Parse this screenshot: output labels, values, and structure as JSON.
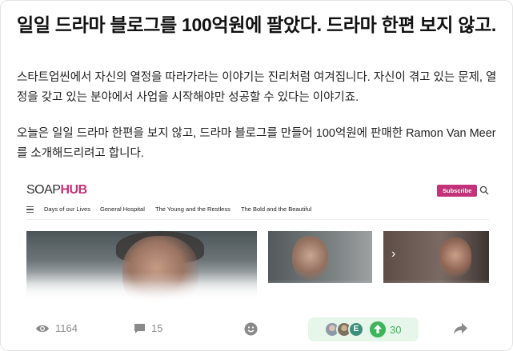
{
  "post": {
    "title": "일일 드라마 블로그를 100억원에 팔았다. 드라마 한편 보지 않고.",
    "paragraph1": "스타트업씬에서 자신의 열정을 따라가라는 이야기는 진리처럼 여겨집니다. 자신이 겪고 있는 문제, 열정을 갖고 있는 분야에서 사업을 시작해야만 성공할 수 있다는 이야기죠.",
    "paragraph2": "오늘은 일일 드라마 한편을 보지 않고, 드라마 블로그를 만들어 100억원에 판매한 Ramon Van Meer를 소개해드리려고 합니다."
  },
  "embed": {
    "logo_soap": "SOAP",
    "logo_hub": "HUB",
    "subscribe_label": "Subscribe",
    "nav_items": [
      "Days of our Lives",
      "General Hospital",
      "The Young and the Restless",
      "The Bold and the Beautiful"
    ],
    "brand_color": "#c4327a"
  },
  "stats": {
    "views": "1164",
    "comments": "15",
    "upvote_avatar_letter": "E",
    "upvotes": "30",
    "upvote_color": "#3fb55a"
  },
  "icons": [
    "eye-icon",
    "comment-icon",
    "emoji-icon",
    "upvote-arrow-icon",
    "share-icon",
    "search-icon",
    "hamburger-icon"
  ]
}
